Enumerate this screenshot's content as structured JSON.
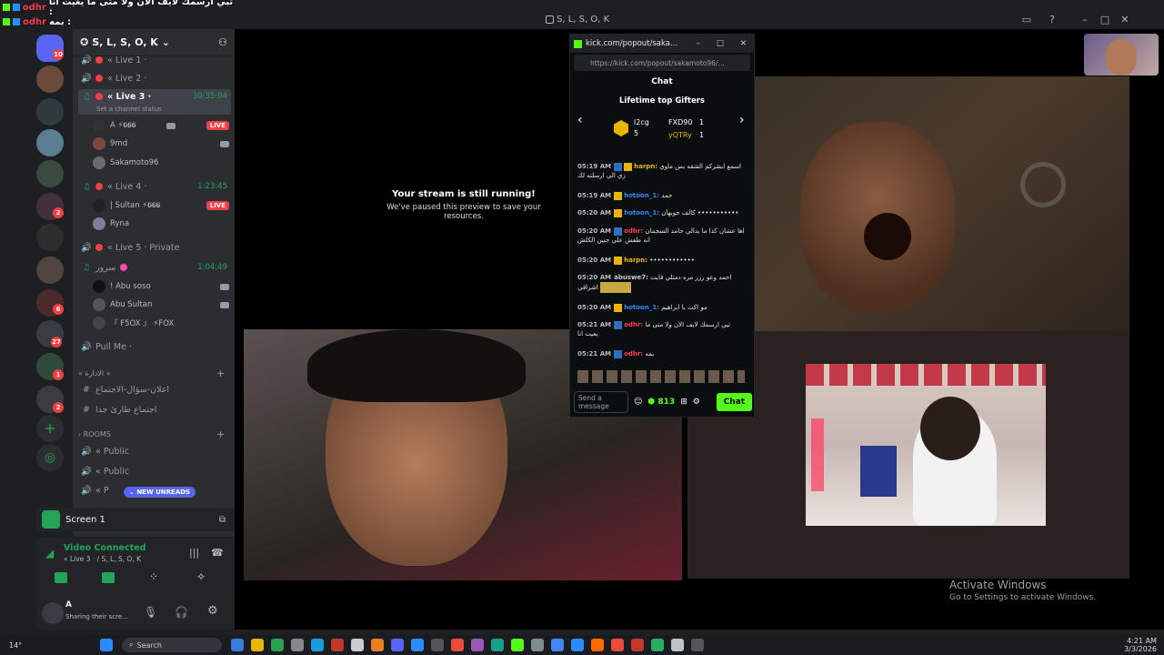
{
  "overlay": {
    "line1_name": "odhr",
    "line1_text": "تبي ارسمك لايف الان ولا متى ما يغيت انا :",
    "line2_name": "odhr",
    "line2_text": "بمه :"
  },
  "window": {
    "title": "S, L, S, O, K"
  },
  "rail": {
    "badges": [
      "10",
      "2",
      "2",
      "6",
      "27",
      "1",
      "2"
    ]
  },
  "sidebar": {
    "server_name": "S, L, S, O, K",
    "channels": [
      {
        "name": "« Live 1 ·",
        "time": ""
      },
      {
        "name": "« Live 2 ·",
        "time": ""
      },
      {
        "name": "« Live 3 ·",
        "time": "30:35:04",
        "status": "Set a channel status"
      },
      {
        "name": "« Live 4 ·",
        "time": "1:23:45"
      },
      {
        "name": "« Live 5 · Private",
        "time": ""
      },
      {
        "name": "سرور",
        "time": "1:04:49"
      },
      {
        "name": "Pull Me ·",
        "time": ""
      }
    ],
    "live3_users": [
      {
        "name": "A ⚡𝟔𝟔𝟔",
        "live": "LIVE"
      },
      {
        "name": "9md",
        "live": ""
      },
      {
        "name": "Sakamoto96",
        "live": ""
      }
    ],
    "live4_users": [
      {
        "name": "| Sultan ⚡𝟔𝟔𝟔",
        "live": "LIVE"
      },
      {
        "name": "Ryna",
        "live": ""
      }
    ],
    "sroor_users": [
      {
        "name": "! Abu soso"
      },
      {
        "name": "Abu Sultan"
      },
      {
        "name": "『 F5OX 』 ⚡FOX"
      }
    ],
    "cat_admin": "« الادارة «",
    "admin_channels": [
      "اعلان-سؤال-الاجتماع",
      "اجتماع طارئ جدا"
    ],
    "cat_rooms": "ROOMS",
    "room_channels": [
      "« Public",
      "« Public",
      "« P"
    ],
    "unreads": "NEW UNREADS"
  },
  "screen_panel": {
    "label": "Screen 1"
  },
  "voice": {
    "status": "Video Connected",
    "location": "« Live 3 · / S, L, S, O, K"
  },
  "user_panel": {
    "name": "A",
    "status": "Sharing their scre..."
  },
  "stage": {
    "stream_title": "Your stream is still running!",
    "stream_sub": "We've paused this preview to save your resources."
  },
  "kick": {
    "window_title": "kick.com/popout/saka...",
    "url": "https://kick.com/popout/sakamoto96/...",
    "chat_header": "Chat",
    "gifters_title": "Lifetime top Gifters",
    "gifters": [
      {
        "name": "l2cg",
        "count": "5"
      },
      {
        "name": "FXD90",
        "count": "1"
      },
      {
        "name": "yQTRy",
        "count": "1"
      }
    ],
    "messages": [
      {
        "time": "05:19 AM",
        "user": "harpn:",
        "color": "#e8b600",
        "text": "اسمع ابشركم الشقه بس ماوي زي الي ارسلته لك"
      },
      {
        "time": "05:19 AM",
        "user": "hotoon_1:",
        "color": "#2c8cff",
        "text": "حمد"
      },
      {
        "time": "05:20 AM",
        "user": "hotoon_1:",
        "color": "#2c8cff",
        "text": "كالف جوبهان •••••••••••"
      },
      {
        "time": "05:20 AM",
        "user": "odhr:",
        "color": "#ff3b5c",
        "text": "اها عشان كذا ما يدالي حامد السجمان انه طفش علي جنين الكلش"
      },
      {
        "time": "05:20 AM",
        "user": "harpn:",
        "color": "#e8b600",
        "text": "••••••••••••"
      },
      {
        "time": "05:20 AM",
        "user": "abuswe7:",
        "color": "#c9c9c9",
        "text": "احمد وعو رزر مره دمثلي قايت اشراقي"
      },
      {
        "time": "05:20 AM",
        "user": "hotoon_1:",
        "color": "#2c8cff",
        "text": "مو اكت يا ابراهيم"
      },
      {
        "time": "05:21 AM",
        "user": "odhr:",
        "color": "#ff3b5c",
        "text": "تبي ارسمك لايف الان ولا متى ما يغيت انا"
      },
      {
        "time": "05:21 AM",
        "user": "odhr:",
        "color": "#ff3b5c",
        "text": "بمه"
      }
    ],
    "input_placeholder": "Send a message",
    "points": "813",
    "chat_button": "Chat"
  },
  "taskbar": {
    "search_label": "Search",
    "temp": "14°",
    "time": "4:21 AM",
    "date": "3/3/2026"
  },
  "watermark": {
    "title": "Activate Windows",
    "sub": "Go to Settings to activate Windows."
  }
}
